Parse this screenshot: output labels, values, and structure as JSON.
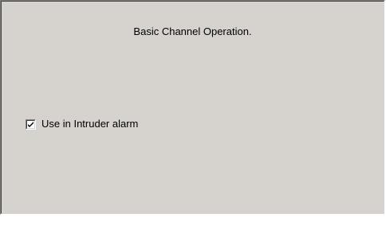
{
  "panel": {
    "title": "Basic Channel Operation."
  },
  "options": {
    "use_in_intruder_alarm": {
      "label": "Use in Intruder alarm",
      "checked": true
    }
  },
  "colors": {
    "panel_background": "#d6d3ce",
    "page_background": "#ffffff"
  },
  "icons": {
    "checkbox_mark": "checkmark-icon"
  }
}
